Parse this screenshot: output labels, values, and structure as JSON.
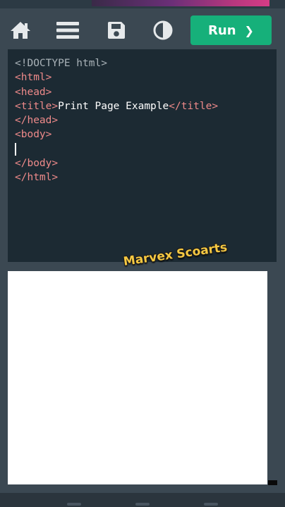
{
  "toolbar": {
    "icons": [
      "home-icon",
      "menu-icon",
      "save-icon",
      "contrast-icon"
    ],
    "run_label": "Run",
    "run_chevron": "❯",
    "run_color": "#16b07a"
  },
  "editor": {
    "lines": [
      {
        "parts": [
          {
            "t": "<!DOCTYPE html>",
            "c": "doctype"
          }
        ]
      },
      {
        "parts": [
          {
            "t": "<html>",
            "c": "tag"
          }
        ]
      },
      {
        "parts": [
          {
            "t": "<head>",
            "c": "tag"
          }
        ]
      },
      {
        "parts": [
          {
            "t": "<title>",
            "c": "tag"
          },
          {
            "t": "Print Page Example",
            "c": "text"
          },
          {
            "t": "</title>",
            "c": "tag"
          }
        ]
      },
      {
        "parts": [
          {
            "t": "</head>",
            "c": "tag"
          }
        ]
      },
      {
        "parts": [
          {
            "t": "<body>",
            "c": "tag"
          }
        ]
      },
      {
        "parts": [],
        "cursor": true
      },
      {
        "parts": [
          {
            "t": "</body>",
            "c": "tag"
          }
        ]
      },
      {
        "parts": [
          {
            "t": "</html>",
            "c": "tag"
          }
        ]
      }
    ]
  },
  "watermark": "Marvex Scoarts",
  "colors": {
    "background": "#3b4852",
    "editor_bg": "#1c2a33",
    "tag": "#ee8a8a",
    "doctype": "#a9b2b8"
  }
}
